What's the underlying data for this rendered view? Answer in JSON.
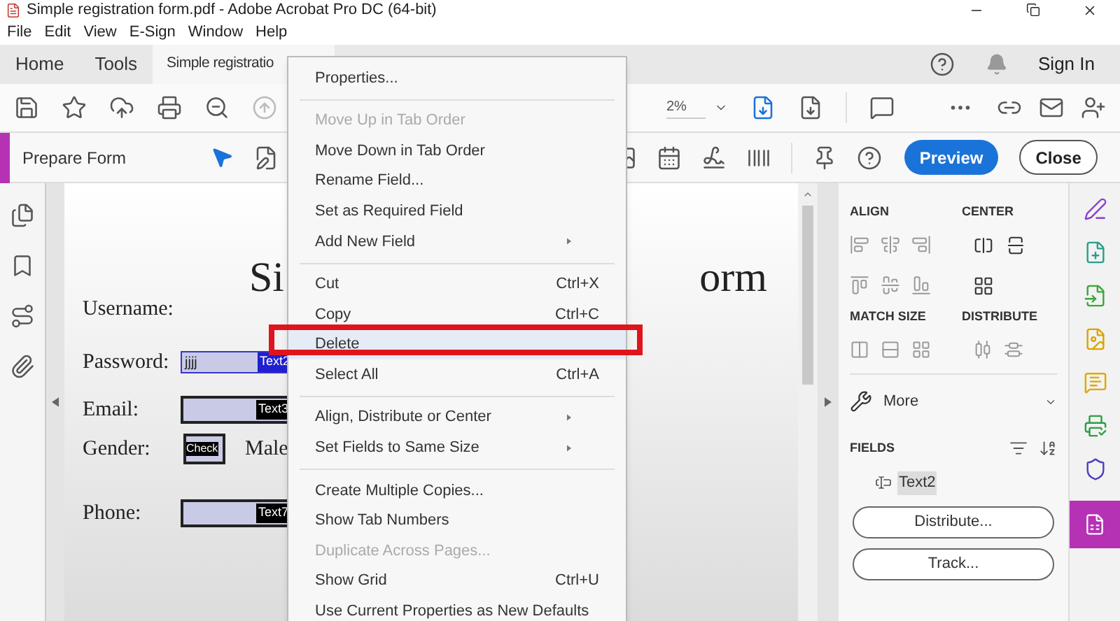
{
  "window": {
    "title": "Simple registration form.pdf - Adobe Acrobat Pro DC (64-bit)"
  },
  "menu_bar": [
    "File",
    "Edit",
    "View",
    "E-Sign",
    "Window",
    "Help"
  ],
  "tabs": [
    {
      "label": "Home",
      "selected": false
    },
    {
      "label": "Tools",
      "selected": false
    },
    {
      "label": "Simple registratio",
      "selected": true
    }
  ],
  "sign_in": "Sign In",
  "zoom": "2%",
  "form_bar": {
    "title": "Prepare Form",
    "preview": "Preview",
    "close": "Close"
  },
  "document": {
    "title_left": "Si",
    "title_right": "orm",
    "rows": [
      {
        "label": "Username:",
        "kind": "label"
      },
      {
        "label": "Password:",
        "kind": "text",
        "value": "jjjj",
        "tag": "Text2",
        "selected": true
      },
      {
        "label": "Email:",
        "kind": "text",
        "tag": "Text3",
        "selected": false
      },
      {
        "label": "Gender:",
        "kind": "checkbox",
        "tag": "Check",
        "option": "Male"
      },
      {
        "label": "Phone:",
        "kind": "text",
        "tag": "Text7",
        "selected": false
      }
    ]
  },
  "context_menu": [
    {
      "kind": "item",
      "label": "Properties...",
      "disabled": false,
      "selected": false
    },
    {
      "kind": "separator"
    },
    {
      "kind": "item",
      "label": "Move Up in Tab Order",
      "disabled": true,
      "selected": false
    },
    {
      "kind": "item",
      "label": "Move Down in Tab Order",
      "disabled": false,
      "selected": false
    },
    {
      "kind": "item",
      "label": "Rename Field...",
      "disabled": false,
      "selected": false
    },
    {
      "kind": "item",
      "label": "Set as Required Field",
      "disabled": false,
      "selected": false
    },
    {
      "kind": "item",
      "label": "Add New Field",
      "disabled": false,
      "selected": false,
      "submenu": true
    },
    {
      "kind": "separator"
    },
    {
      "kind": "item",
      "label": "Cut",
      "shortcut": "Ctrl+X",
      "disabled": false,
      "selected": false
    },
    {
      "kind": "item",
      "label": "Copy",
      "shortcut": "Ctrl+C",
      "disabled": false,
      "selected": false
    },
    {
      "kind": "item",
      "label": "Delete",
      "disabled": false,
      "selected": true
    },
    {
      "kind": "item",
      "label": "Select All",
      "shortcut": "Ctrl+A",
      "disabled": false,
      "selected": false
    },
    {
      "kind": "separator"
    },
    {
      "kind": "item",
      "label": "Align, Distribute or Center",
      "disabled": false,
      "selected": false,
      "submenu": true
    },
    {
      "kind": "item",
      "label": "Set Fields to Same Size",
      "disabled": false,
      "selected": false,
      "submenu": true
    },
    {
      "kind": "separator"
    },
    {
      "kind": "item",
      "label": "Create Multiple Copies...",
      "disabled": false,
      "selected": false
    },
    {
      "kind": "item",
      "label": "Show Tab Numbers",
      "disabled": false,
      "selected": false
    },
    {
      "kind": "item",
      "label": "Duplicate Across Pages...",
      "disabled": true,
      "selected": false
    },
    {
      "kind": "item",
      "label": "Show Grid",
      "shortcut": "Ctrl+U",
      "disabled": false,
      "selected": false
    },
    {
      "kind": "item",
      "label": "Use Current Properties as New Defaults",
      "disabled": false,
      "selected": false
    }
  ],
  "right_panel": {
    "align": "ALIGN",
    "center": "CENTER",
    "match_size": "MATCH SIZE",
    "distribute": "DISTRIBUTE",
    "more": "More",
    "fields": {
      "heading": "FIELDS",
      "items": [
        {
          "label": "Text2",
          "selected": true
        }
      ]
    },
    "buttons": [
      "Distribute...",
      "Track..."
    ]
  }
}
